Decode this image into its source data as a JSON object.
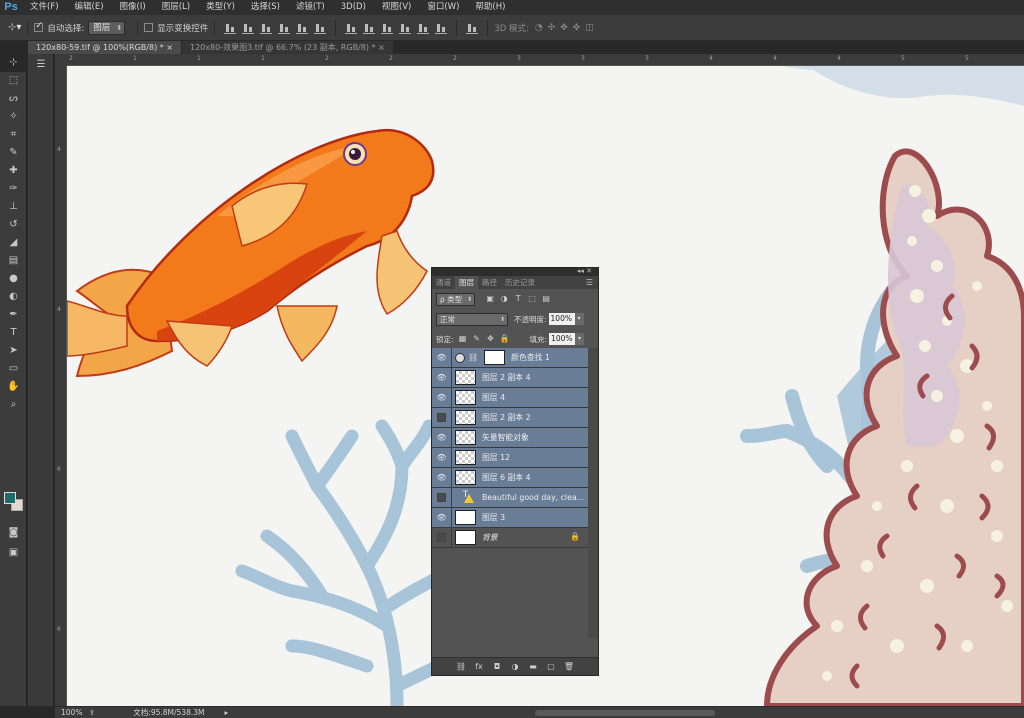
{
  "app": {
    "logo": "Ps"
  },
  "menu": [
    "文件(F)",
    "编辑(E)",
    "图像(I)",
    "图层(L)",
    "类型(Y)",
    "选择(S)",
    "滤镜(T)",
    "3D(D)",
    "视图(V)",
    "窗口(W)",
    "帮助(H)"
  ],
  "options": {
    "auto_select_label": "自动选择:",
    "auto_select_value": "图层",
    "show_transform_label": "显示变换控件",
    "mode_3d_label": "3D 模式:"
  },
  "tabs": [
    {
      "label": "120x80-59.tif @ 100%(RGB/8) *",
      "close": "×"
    },
    {
      "label": "120x80-效果图3.tif @ 66.7% (23 副本, RGB/8) *",
      "close": "×"
    }
  ],
  "ruler": {
    "top": [
      "2",
      "1",
      "1",
      "1",
      "2",
      "2",
      "2",
      "3",
      "3",
      "3",
      "4",
      "4",
      "4",
      "5",
      "5"
    ],
    "left": [
      "4",
      "4",
      "6",
      "6"
    ]
  },
  "layers_panel": {
    "tabs": [
      "通道",
      "图层",
      "路径",
      "历史记录"
    ],
    "filter_label": "ρ 类型",
    "blend_mode": "正常",
    "opacity_label": "不透明度:",
    "opacity_value": "100%",
    "lock_label": "锁定:",
    "fill_label": "填充:",
    "fill_value": "100%",
    "layers": [
      {
        "name": "颜色查找 1",
        "visible": true,
        "type": "adjustment"
      },
      {
        "name": "图层 2 副本 4",
        "visible": true,
        "type": "pixel"
      },
      {
        "name": "图层 4",
        "visible": true,
        "type": "pixel"
      },
      {
        "name": "图层 2 副本 2",
        "visible": false,
        "type": "pixel"
      },
      {
        "name": "矢量智能对象",
        "visible": true,
        "type": "smart"
      },
      {
        "name": "图层 12",
        "visible": true,
        "type": "pixel"
      },
      {
        "name": "图层 6 副本 4",
        "visible": true,
        "type": "pixel"
      },
      {
        "name": "Beautiful good day, clea...",
        "visible": false,
        "type": "text"
      },
      {
        "name": "图层 3",
        "visible": true,
        "type": "white"
      },
      {
        "name": "背景",
        "visible": false,
        "type": "background"
      }
    ]
  },
  "status": {
    "zoom": "100%",
    "doc_info": "文档:95.8M/538.3M"
  },
  "colors": {
    "foreground": "#1f6b6a",
    "background": "#e8d8cc",
    "accent": "#4ea6ea",
    "selected_layer": "#6a7d97"
  }
}
